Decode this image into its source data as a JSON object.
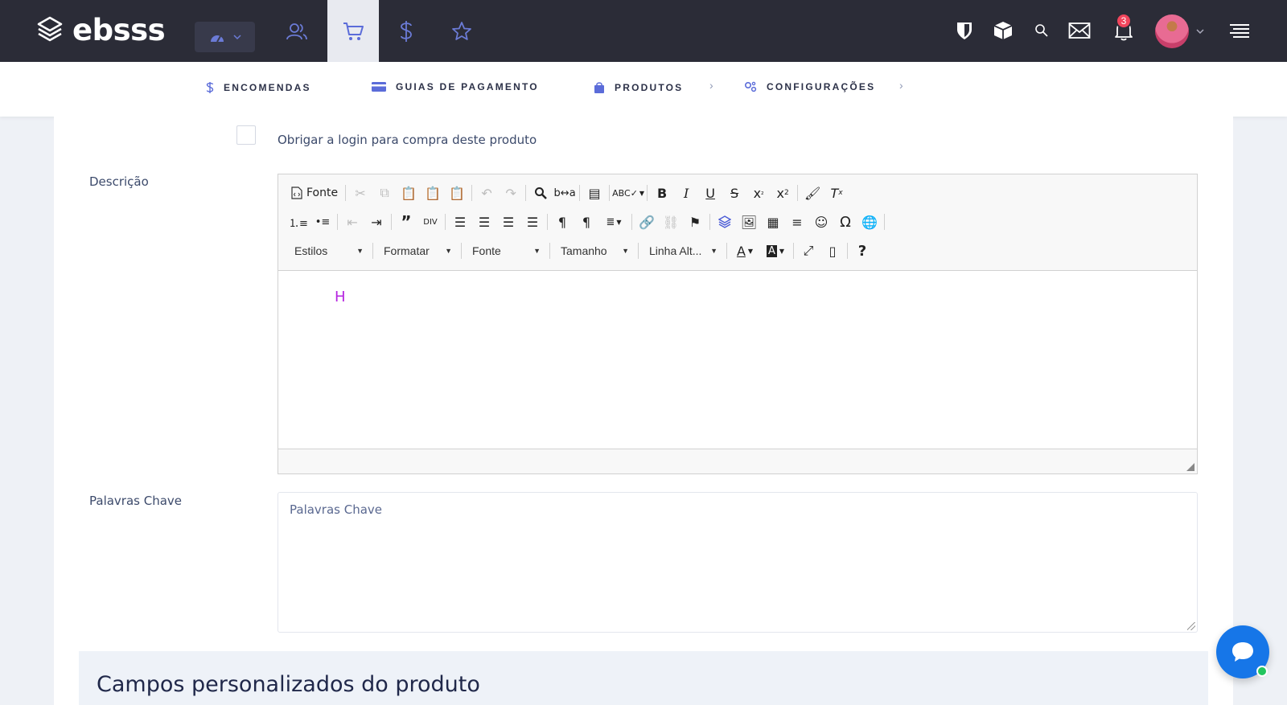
{
  "header": {
    "logo_text": "ebsss",
    "notifications_count": "3"
  },
  "subnav": {
    "items": [
      {
        "label": "ENCOMENDAS",
        "icon": "dollar-icon"
      },
      {
        "label": "GUIAS DE PAGAMENTO",
        "icon": "credit-card-icon"
      },
      {
        "label": "PRODUTOS",
        "icon": "shopping-bag-icon"
      },
      {
        "label": "CONFIGURAÇÕES",
        "icon": "cogs-icon"
      }
    ]
  },
  "form": {
    "login_required_label": "Obrigar a login para compra deste produto",
    "description_label": "Descrição",
    "keywords_label": "Palavras Chave",
    "keywords_placeholder": "Palavras Chave"
  },
  "editor": {
    "source_label": "Fonte",
    "combos": {
      "styles": "Estilos",
      "format": "Formatar",
      "font": "Fonte",
      "size": "Tamanho",
      "line_height": "Linha Alt..."
    },
    "content": "H"
  },
  "section": {
    "title": "Campos personalizados do produto"
  },
  "colors": {
    "topbar": "#2b2c37",
    "accent": "#5b6cd9",
    "editor_text": "#b524e0",
    "chat": "#1676e8"
  }
}
